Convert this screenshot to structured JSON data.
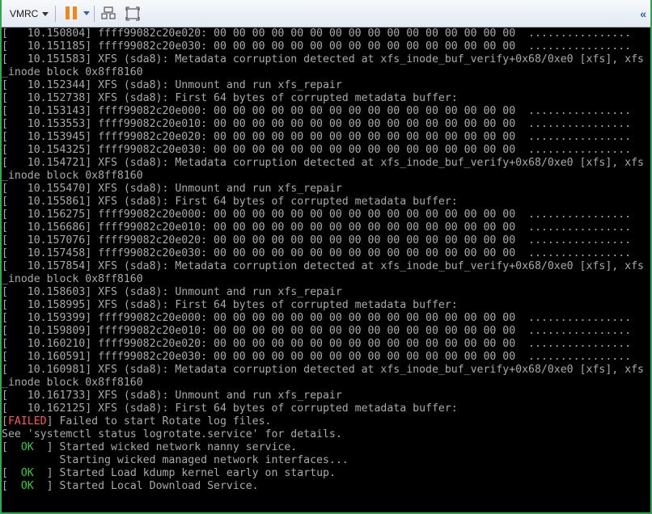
{
  "toolbar": {
    "menu_label": "VMRC",
    "icons": [
      "pause-icon",
      "dropdown-icon",
      "send-ctrl-alt-del-icon",
      "fullscreen-icon",
      "collapse-icon"
    ]
  },
  "console": {
    "lines": [
      "[   10.150804] ffff99082c20e020: 00 00 00 00 00 00 00 00 00 00 00 00 00 00 00 00  ................",
      "[   10.151185] ffff99082c20e030: 00 00 00 00 00 00 00 00 00 00 00 00 00 00 00 00  ................",
      "[   10.151583] XFS (sda8): Metadata corruption detected at xfs_inode_buf_verify+0x68/0xe0 [xfs], xfs",
      "_inode block 0x8ff8160",
      "[   10.152344] XFS (sda8): Unmount and run xfs_repair",
      "[   10.152738] XFS (sda8): First 64 bytes of corrupted metadata buffer:",
      "[   10.153143] ffff99082c20e000: 00 00 00 00 00 00 00 00 00 00 00 00 00 00 00 00  ................",
      "[   10.153553] ffff99082c20e010: 00 00 00 00 00 00 00 00 00 00 00 00 00 00 00 00  ................",
      "[   10.153945] ffff99082c20e020: 00 00 00 00 00 00 00 00 00 00 00 00 00 00 00 00  ................",
      "[   10.154325] ffff99082c20e030: 00 00 00 00 00 00 00 00 00 00 00 00 00 00 00 00  ................",
      "[   10.154721] XFS (sda8): Metadata corruption detected at xfs_inode_buf_verify+0x68/0xe0 [xfs], xfs",
      "_inode block 0x8ff8160",
      "[   10.155470] XFS (sda8): Unmount and run xfs_repair",
      "[   10.155861] XFS (sda8): First 64 bytes of corrupted metadata buffer:",
      "[   10.156275] ffff99082c20e000: 00 00 00 00 00 00 00 00 00 00 00 00 00 00 00 00  ................",
      "[   10.156686] ffff99082c20e010: 00 00 00 00 00 00 00 00 00 00 00 00 00 00 00 00  ................",
      "[   10.157076] ffff99082c20e020: 00 00 00 00 00 00 00 00 00 00 00 00 00 00 00 00  ................",
      "[   10.157458] ffff99082c20e030: 00 00 00 00 00 00 00 00 00 00 00 00 00 00 00 00  ................",
      "[   10.157854] XFS (sda8): Metadata corruption detected at xfs_inode_buf_verify+0x68/0xe0 [xfs], xfs",
      "_inode block 0x8ff8160",
      "[   10.158603] XFS (sda8): Unmount and run xfs_repair",
      "[   10.158995] XFS (sda8): First 64 bytes of corrupted metadata buffer:",
      "[   10.159399] ffff99082c20e000: 00 00 00 00 00 00 00 00 00 00 00 00 00 00 00 00  ................",
      "[   10.159809] ffff99082c20e010: 00 00 00 00 00 00 00 00 00 00 00 00 00 00 00 00  ................",
      "[   10.160210] ffff99082c20e020: 00 00 00 00 00 00 00 00 00 00 00 00 00 00 00 00  ................",
      "[   10.160591] ffff99082c20e030: 00 00 00 00 00 00 00 00 00 00 00 00 00 00 00 00  ................",
      "[   10.160981] XFS (sda8): Metadata corruption detected at xfs_inode_buf_verify+0x68/0xe0 [xfs], xfs",
      "_inode block 0x8ff8160",
      "[   10.161733] XFS (sda8): Unmount and run xfs_repair",
      "[   10.162125] XFS (sda8): First 64 bytes of corrupted metadata buffer:"
    ],
    "failed_line": {
      "open": "[",
      "tag": "FAILED",
      "close": "]",
      "text": " Failed to start Rotate log files."
    },
    "hint_line": "See 'systemctl status logrotate.service' for details.",
    "ok_lines": [
      {
        "open": "[  ",
        "tag": "OK",
        "close": "  ]",
        "text": " Started wicked network nanny service."
      },
      {
        "open": "",
        "tag": "",
        "close": "",
        "text": "         Starting wicked managed network interfaces..."
      },
      {
        "open": "[  ",
        "tag": "OK",
        "close": "  ]",
        "text": " Started Load kdump kernel early on startup."
      },
      {
        "open": "[  ",
        "tag": "OK",
        "close": "  ]",
        "text": " Started Local Download Service."
      }
    ],
    "colors": {
      "background": "#000000",
      "text": "#aaaaaa",
      "failed": "#ff5555",
      "ok": "#33cc33"
    }
  }
}
